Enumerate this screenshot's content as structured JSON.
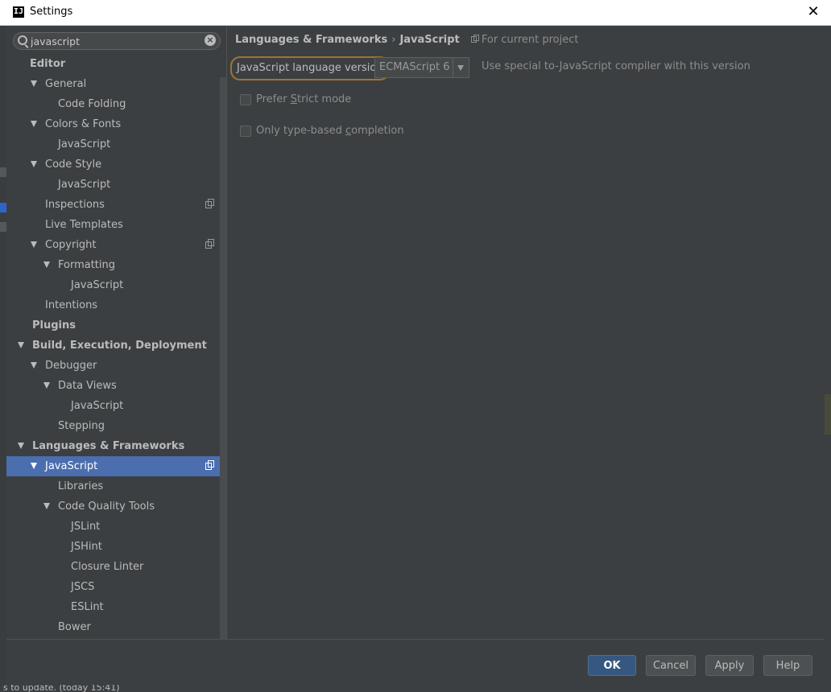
{
  "window": {
    "title": "Settings",
    "app_icon_letter": "IJ"
  },
  "search": {
    "value": "javascript"
  },
  "tree": [
    {
      "label": "Editor",
      "level": 0,
      "arrow": false,
      "bold": true,
      "project_icon": false,
      "selected": false
    },
    {
      "label": "General",
      "level": 1,
      "arrow": true,
      "bold": false,
      "project_icon": false,
      "selected": false
    },
    {
      "label": "Code Folding",
      "level": 2,
      "arrow": false,
      "bold": false,
      "project_icon": false,
      "selected": false
    },
    {
      "label": "Colors & Fonts",
      "level": 1,
      "arrow": true,
      "bold": false,
      "project_icon": false,
      "selected": false
    },
    {
      "label": "JavaScript",
      "level": 2,
      "arrow": false,
      "bold": false,
      "project_icon": false,
      "selected": false
    },
    {
      "label": "Code Style",
      "level": 1,
      "arrow": true,
      "bold": false,
      "project_icon": false,
      "selected": false
    },
    {
      "label": "JavaScript",
      "level": 2,
      "arrow": false,
      "bold": false,
      "project_icon": false,
      "selected": false
    },
    {
      "label": "Inspections",
      "level": 1,
      "arrow": false,
      "bold": false,
      "project_icon": true,
      "selected": false
    },
    {
      "label": "Live Templates",
      "level": 1,
      "arrow": false,
      "bold": false,
      "project_icon": false,
      "selected": false
    },
    {
      "label": "Copyright",
      "level": 1,
      "arrow": true,
      "bold": false,
      "project_icon": true,
      "selected": false
    },
    {
      "label": "Formatting",
      "level": 2,
      "arrow": true,
      "bold": false,
      "project_icon": false,
      "selected": false
    },
    {
      "label": "JavaScript",
      "level": 3,
      "arrow": false,
      "bold": false,
      "project_icon": false,
      "selected": false
    },
    {
      "label": "Intentions",
      "level": 1,
      "arrow": false,
      "bold": false,
      "project_icon": false,
      "selected": false
    },
    {
      "label": "Plugins",
      "level": 0,
      "arrow": false,
      "bold": true,
      "project_icon": false,
      "selected": false
    },
    {
      "label": "Build, Execution, Deployment",
      "level": 0,
      "arrow": true,
      "bold": true,
      "project_icon": false,
      "selected": false
    },
    {
      "label": "Debugger",
      "level": 1,
      "arrow": true,
      "bold": false,
      "project_icon": false,
      "selected": false
    },
    {
      "label": "Data Views",
      "level": 2,
      "arrow": true,
      "bold": false,
      "project_icon": false,
      "selected": false
    },
    {
      "label": "JavaScript",
      "level": 3,
      "arrow": false,
      "bold": false,
      "project_icon": false,
      "selected": false
    },
    {
      "label": "Stepping",
      "level": 2,
      "arrow": false,
      "bold": false,
      "project_icon": false,
      "selected": false
    },
    {
      "label": "Languages & Frameworks",
      "level": 0,
      "arrow": true,
      "bold": true,
      "project_icon": false,
      "selected": false
    },
    {
      "label": "JavaScript",
      "level": 1,
      "arrow": true,
      "bold": false,
      "project_icon": true,
      "selected": true
    },
    {
      "label": "Libraries",
      "level": 2,
      "arrow": false,
      "bold": false,
      "project_icon": false,
      "selected": false
    },
    {
      "label": "Code Quality Tools",
      "level": 2,
      "arrow": true,
      "bold": false,
      "project_icon": false,
      "selected": false
    },
    {
      "label": "JSLint",
      "level": 3,
      "arrow": false,
      "bold": false,
      "project_icon": false,
      "selected": false
    },
    {
      "label": "JSHint",
      "level": 3,
      "arrow": false,
      "bold": false,
      "project_icon": false,
      "selected": false
    },
    {
      "label": "Closure Linter",
      "level": 3,
      "arrow": false,
      "bold": false,
      "project_icon": false,
      "selected": false
    },
    {
      "label": "JSCS",
      "level": 3,
      "arrow": false,
      "bold": false,
      "project_icon": false,
      "selected": false
    },
    {
      "label": "ESLint",
      "level": 3,
      "arrow": false,
      "bold": false,
      "project_icon": false,
      "selected": false
    },
    {
      "label": "Bower",
      "level": 2,
      "arrow": false,
      "bold": false,
      "project_icon": false,
      "selected": false
    }
  ],
  "breadcrumb": {
    "parent": "Languages & Frameworks",
    "separator": "›",
    "current": "JavaScript",
    "scope": "For current project"
  },
  "settings": {
    "lang_version_label": "JavaScript language version",
    "lang_version_value": "ECMAScript 6",
    "compiler_hint": "Use special to-JavaScript compiler with this version",
    "strict_mode": {
      "before": "Prefer ",
      "mnemonic": "S",
      "after": "trict mode",
      "checked": false
    },
    "type_completion": {
      "before": "Only type-based ",
      "mnemonic": "c",
      "after": "ompletion",
      "checked": false
    }
  },
  "buttons": {
    "ok": "OK",
    "cancel": "Cancel",
    "apply": "Apply",
    "help": "Help"
  },
  "status": {
    "text": "s to update. (today 15:41)"
  },
  "colors": {
    "selection": "#4b6eaf",
    "panel": "#3c3f41",
    "focus_ring": "#a0733a",
    "primary_button": "#365880"
  }
}
